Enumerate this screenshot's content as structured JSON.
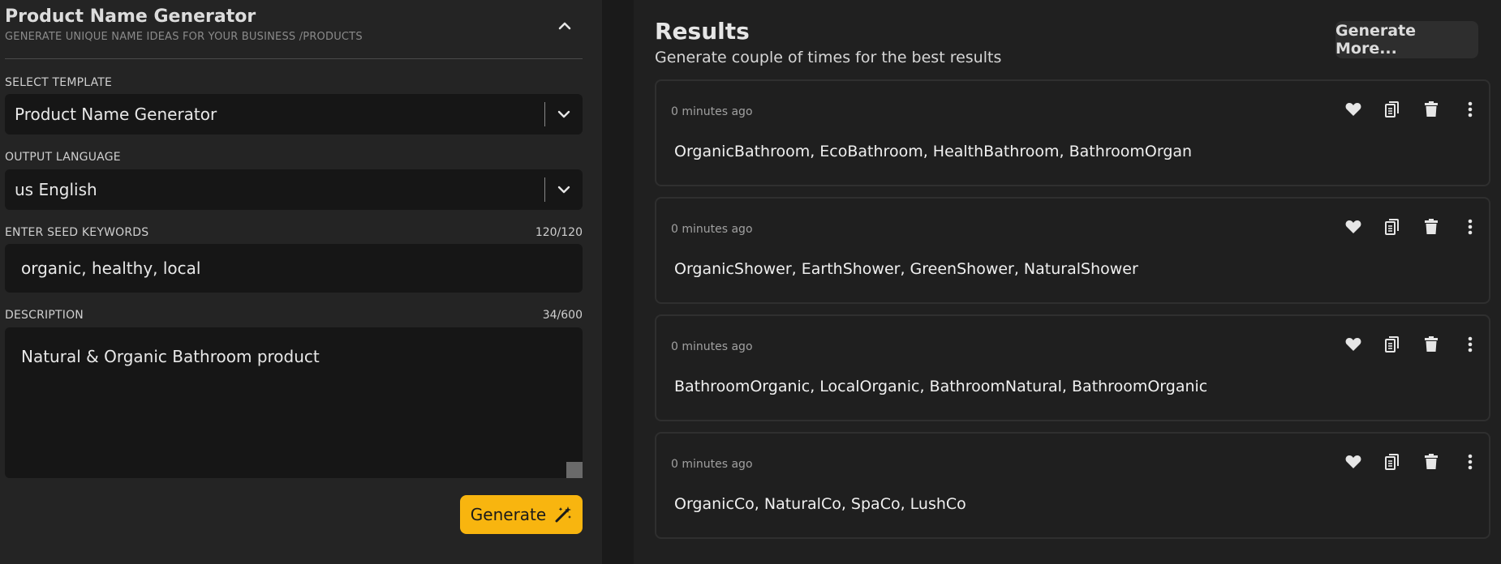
{
  "generator": {
    "title": "Product Name Generator",
    "subtitle": "GENERATE UNIQUE NAME IDEAS FOR YOUR BUSINESS /PRODUCTS",
    "select_template": {
      "label": "SELECT TEMPLATE",
      "value": "Product Name Generator"
    },
    "output_language": {
      "label": "OUTPUT LANGUAGE",
      "value": "us English"
    },
    "seed_keywords": {
      "label": "ENTER SEED KEYWORDS",
      "counter": "120/120",
      "value": "organic, healthy, local"
    },
    "description": {
      "label": "DESCRIPTION",
      "counter": "34/600",
      "value": "Natural & Organic Bathroom product"
    },
    "generate_label": "Generate"
  },
  "results": {
    "title": "Results",
    "subtitle": "Generate couple of times for the best results",
    "generate_more_label": "Generate More...",
    "items": [
      {
        "time": "0 minutes ago",
        "text": "OrganicBathroom, EcoBathroom, HealthBathroom, BathroomOrgan"
      },
      {
        "time": "0 minutes ago",
        "text": "OrganicShower, EarthShower, GreenShower, NaturalShower"
      },
      {
        "time": "0 minutes ago",
        "text": "BathroomOrganic, LocalOrganic, BathroomNatural, BathroomOrganic"
      },
      {
        "time": "0 minutes ago",
        "text": "OrganicCo, NaturalCo, SpaCo, LushCo"
      }
    ]
  },
  "colors": {
    "accent": "#f8b50f",
    "panel_bg": "#242424",
    "input_bg": "#161616"
  },
  "icons": [
    "chevron-up-icon",
    "chevron-down-icon",
    "magic-wand-icon",
    "heart-icon",
    "copy-icon",
    "trash-icon",
    "more-vertical-icon"
  ]
}
